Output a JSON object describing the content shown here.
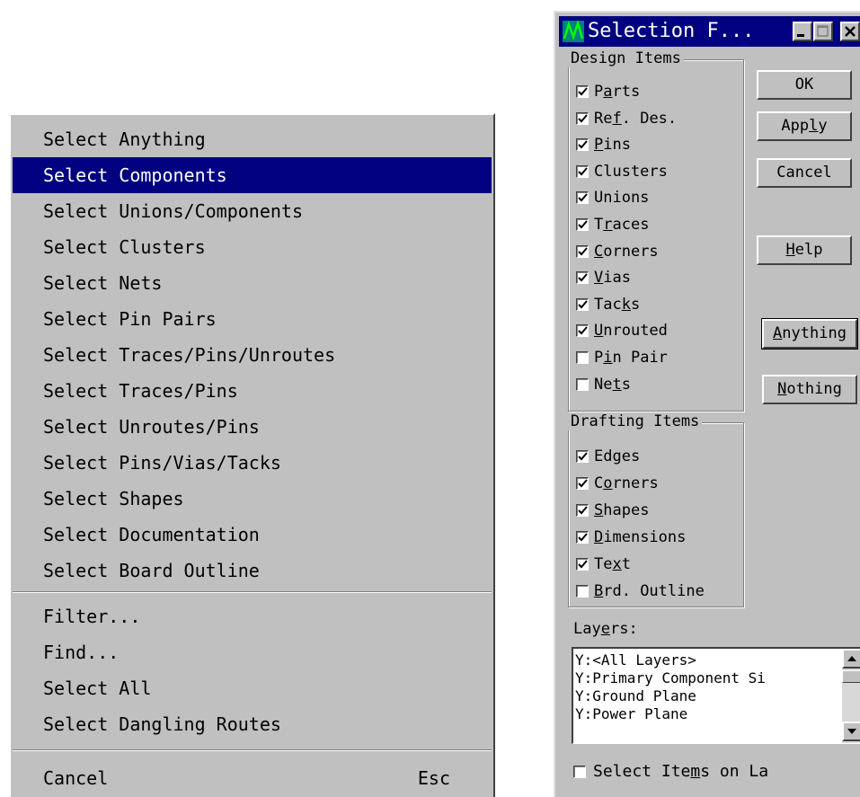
{
  "menu": {
    "items": [
      {
        "label": "Select Anything"
      },
      {
        "label": "Select Components",
        "selected": true
      },
      {
        "label": "Select Unions/Components"
      },
      {
        "label": "Select Clusters"
      },
      {
        "label": "Select Nets"
      },
      {
        "label": "Select Pin Pairs"
      },
      {
        "label": "Select Traces/Pins/Unroutes"
      },
      {
        "label": "Select Traces/Pins"
      },
      {
        "label": "Select Unroutes/Pins"
      },
      {
        "label": "Select Pins/Vias/Tacks"
      },
      {
        "label": "Select Shapes"
      },
      {
        "label": "Select Documentation"
      },
      {
        "label": "Select Board Outline"
      }
    ],
    "tools": [
      {
        "label": "Filter..."
      },
      {
        "label": "Find..."
      },
      {
        "label": "Select All"
      },
      {
        "label": "Select Dangling Routes"
      }
    ],
    "cancel": {
      "label": "Cancel",
      "shortcut": "Esc"
    }
  },
  "dialog": {
    "title": "Selection F...",
    "design_items": {
      "legend": "Design Items",
      "items": [
        {
          "pre": "P",
          "key": "a",
          "post": "rts",
          "checked": true
        },
        {
          "pre": "Re",
          "key": "f",
          "post": ". Des.",
          "checked": true
        },
        {
          "pre": "",
          "key": "P",
          "post": "ins",
          "checked": true
        },
        {
          "pre": "Clusters",
          "key": "",
          "post": "",
          "checked": true
        },
        {
          "pre": "Unions",
          "key": "",
          "post": "",
          "checked": true
        },
        {
          "pre": "T",
          "key": "r",
          "post": "aces",
          "checked": true
        },
        {
          "pre": "",
          "key": "C",
          "post": "orners",
          "checked": true
        },
        {
          "pre": "",
          "key": "V",
          "post": "ias",
          "checked": true
        },
        {
          "pre": "Tac",
          "key": "k",
          "post": "s",
          "checked": true
        },
        {
          "pre": "",
          "key": "U",
          "post": "nrouted",
          "checked": true
        },
        {
          "pre": "P",
          "key": "i",
          "post": "n Pair",
          "checked": false
        },
        {
          "pre": "Ne",
          "key": "t",
          "post": "s",
          "checked": false
        }
      ]
    },
    "drafting_items": {
      "legend": "Drafting Items",
      "items": [
        {
          "pre": "Edges",
          "key": "",
          "post": "",
          "checked": true
        },
        {
          "pre": "C",
          "key": "o",
          "post": "rners",
          "checked": true
        },
        {
          "pre": "",
          "key": "S",
          "post": "hapes",
          "checked": true
        },
        {
          "pre": "",
          "key": "D",
          "post": "imensions",
          "checked": true
        },
        {
          "pre": "Te",
          "key": "x",
          "post": "t",
          "checked": true
        },
        {
          "pre": "",
          "key": "B",
          "post": "rd. Outline",
          "checked": false
        }
      ]
    },
    "buttons": [
      {
        "pre": "OK",
        "key": "",
        "post": ""
      },
      {
        "pre": "App",
        "key": "l",
        "post": "y"
      },
      {
        "pre": "Cancel",
        "key": "",
        "post": ""
      },
      {
        "pre": "",
        "key": "H",
        "post": "elp"
      },
      {
        "pre": "",
        "key": "A",
        "post": "nything",
        "focused": true
      },
      {
        "pre": "",
        "key": "N",
        "post": "othing"
      }
    ],
    "layers": {
      "label_pre": "Lay",
      "label_key": "e",
      "label_post": "rs:",
      "items": [
        "Y:<All Layers>",
        "Y:Primary Component Si",
        "Y:Ground Plane",
        "Y:Power Plane"
      ]
    },
    "select_on_layer": {
      "pre": "Select Ite",
      "key": "m",
      "post": "s on La",
      "checked": false
    }
  }
}
